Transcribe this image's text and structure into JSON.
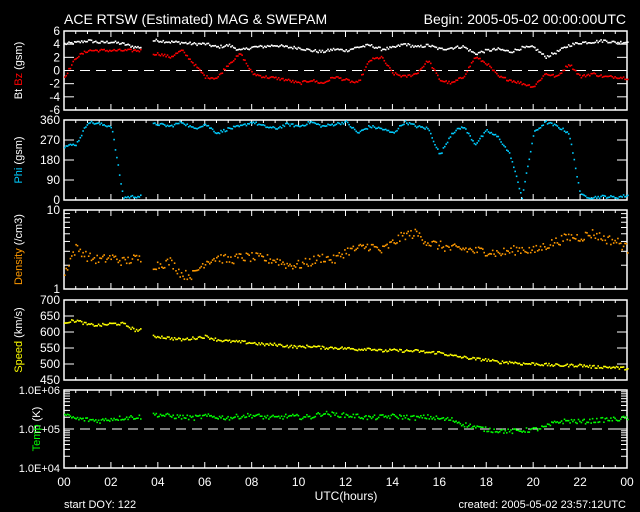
{
  "header": {
    "title": "ACE RTSW (Estimated) MAG & SWEPAM",
    "begin": "Begin: 2005-05-02 00:00:00UTC"
  },
  "footer": {
    "start_doy": "start DOY: 122",
    "created": "created: 2005-05-02 23:57:12UTC",
    "xlabel": "UTC(hours)"
  },
  "chart_data": [
    {
      "type": "scatter",
      "ylabel_parts": [
        "Bt",
        "Bz",
        "(gsm)"
      ],
      "ylabel_colors": [
        "#ffffff",
        "#ff0000",
        "#ffffff"
      ],
      "ylim": [
        -6,
        6
      ],
      "yticks": [
        "6",
        "4",
        "2",
        "0",
        "-2",
        "-4",
        "-6"
      ],
      "reference_line": 0,
      "x": [
        0,
        0.5,
        1,
        1.5,
        2,
        2.5,
        3,
        3.5,
        4,
        4.5,
        5,
        5.5,
        6,
        6.5,
        7,
        7.5,
        8,
        8.5,
        9,
        9.5,
        10,
        10.5,
        11,
        11.5,
        12,
        12.5,
        13,
        13.5,
        14,
        14.5,
        15,
        15.5,
        16,
        16.5,
        17,
        17.5,
        18,
        18.5,
        19,
        19.5,
        20,
        20.5,
        21,
        21.5,
        22,
        22.5,
        23,
        23.5,
        24
      ],
      "series": [
        {
          "name": "Bt",
          "color": "#ffffff",
          "values": [
            4,
            4.2,
            4.5,
            4.2,
            4.3,
            4,
            3.5,
            null,
            4.5,
            4.3,
            4.2,
            4,
            4,
            3.5,
            3.8,
            3,
            3.5,
            3.6,
            3.8,
            3.5,
            3.4,
            3,
            2.8,
            3.2,
            3,
            3.5,
            3.8,
            3.2,
            3.4,
            4,
            3.5,
            3.8,
            3.2,
            3.4,
            3.6,
            2.5,
            3,
            3.2,
            2.8,
            3.4,
            3.5,
            2,
            2.8,
            3.8,
            4.2,
            4.3,
            4.5,
            4.2,
            4.3
          ]
        },
        {
          "name": "Bz",
          "color": "#ff0000",
          "values": [
            -1,
            2,
            3,
            3,
            3,
            3,
            3,
            null,
            2.5,
            2,
            3,
            1,
            -1,
            -1.2,
            1,
            2.5,
            -0.5,
            -1,
            -1.2,
            -1.5,
            -2,
            -1.5,
            -2,
            -1,
            -1.5,
            -2,
            1.5,
            2,
            -0.5,
            -1,
            -0.5,
            1.5,
            -1.5,
            -2,
            -1,
            2,
            1,
            -1,
            -1.5,
            -2,
            -2.5,
            -0.5,
            -1,
            1,
            -1,
            -0.5,
            -1,
            -1,
            -1.2
          ]
        }
      ]
    },
    {
      "type": "scatter",
      "ylabel_parts": [
        "Phi",
        "(gsm)"
      ],
      "ylabel_colors": [
        "#00ccff",
        "#ffffff"
      ],
      "ylim": [
        0,
        360
      ],
      "yticks": [
        "360",
        "270",
        "180",
        "90",
        "0"
      ],
      "x": [
        0,
        0.5,
        1,
        1.5,
        2,
        2.5,
        3,
        3.5,
        4,
        4.5,
        5,
        5.5,
        6,
        6.5,
        7,
        7.5,
        8,
        8.5,
        9,
        9.5,
        10,
        10.5,
        11,
        11.5,
        12,
        12.5,
        13,
        13.5,
        14,
        14.5,
        15,
        15.5,
        16,
        16.5,
        17,
        17.5,
        18,
        18.5,
        19,
        19.5,
        20,
        20.5,
        21,
        21.5,
        22,
        22.5,
        23,
        23.5,
        24
      ],
      "series": [
        {
          "name": "Phi",
          "color": "#00ccff",
          "values": [
            240,
            250,
            350,
            340,
            330,
            10,
            15,
            null,
            340,
            330,
            350,
            320,
            340,
            300,
            320,
            330,
            350,
            330,
            320,
            340,
            330,
            350,
            330,
            340,
            350,
            300,
            330,
            320,
            300,
            350,
            330,
            320,
            200,
            300,
            330,
            250,
            310,
            280,
            200,
            10,
            300,
            350,
            330,
            300,
            20,
            10,
            15,
            10,
            20
          ]
        }
      ]
    },
    {
      "type": "scatter",
      "ylabel_parts": [
        "Density",
        "(/cm3)"
      ],
      "ylabel_colors": [
        "#ff9900",
        "#ffffff"
      ],
      "yscale": "log",
      "ylim": [
        1,
        10
      ],
      "yticks": [
        "10",
        "1"
      ],
      "x": [
        0,
        0.5,
        1,
        1.5,
        2,
        2.5,
        3,
        3.5,
        4,
        4.5,
        5,
        5.5,
        6,
        6.5,
        7,
        7.5,
        8,
        8.5,
        9,
        9.5,
        10,
        10.5,
        11,
        11.5,
        12,
        12.5,
        13,
        13.5,
        14,
        14.5,
        15,
        15.5,
        16,
        16.5,
        17,
        17.5,
        18,
        18.5,
        19,
        19.5,
        20,
        20.5,
        21,
        21.5,
        22,
        22.5,
        23,
        23.5,
        24
      ],
      "series": [
        {
          "name": "Density",
          "color": "#ff9900",
          "values": [
            1.5,
            3.3,
            2.5,
            2.3,
            2.5,
            2.2,
            2.4,
            null,
            2,
            2.2,
            1.5,
            1.5,
            2.2,
            2.5,
            2.3,
            2.5,
            2.5,
            2.4,
            2.3,
            2,
            2,
            2.2,
            2.5,
            2.3,
            3,
            3.2,
            3.5,
            3,
            3.8,
            4.8,
            5,
            3.8,
            3.5,
            3.2,
            3.2,
            3,
            3,
            2.8,
            3,
            3.2,
            3,
            3.5,
            4,
            4.5,
            4.5,
            5,
            4.3,
            4,
            3.2
          ]
        }
      ]
    },
    {
      "type": "scatter",
      "ylabel_parts": [
        "Speed",
        "(km/s)"
      ],
      "ylabel_colors": [
        "#ffff00",
        "#ffffff"
      ],
      "ylim": [
        450,
        700
      ],
      "yticks": [
        "700",
        "650",
        "600",
        "550",
        "500",
        "450"
      ],
      "x": [
        0,
        0.5,
        1,
        1.5,
        2,
        2.5,
        3,
        3.5,
        4,
        4.5,
        5,
        5.5,
        6,
        6.5,
        7,
        7.5,
        8,
        8.5,
        9,
        9.5,
        10,
        10.5,
        11,
        11.5,
        12,
        12.5,
        13,
        13.5,
        14,
        14.5,
        15,
        15.5,
        16,
        16.5,
        17,
        17.5,
        18,
        18.5,
        19,
        19.5,
        20,
        20.5,
        21,
        21.5,
        22,
        22.5,
        23,
        23.5,
        24
      ],
      "series": [
        {
          "name": "Speed",
          "color": "#ffff00",
          "values": [
            630,
            635,
            622,
            620,
            625,
            625,
            605,
            null,
            585,
            580,
            575,
            580,
            585,
            575,
            570,
            568,
            565,
            560,
            560,
            555,
            552,
            555,
            550,
            550,
            548,
            545,
            548,
            540,
            542,
            540,
            540,
            535,
            535,
            525,
            520,
            515,
            512,
            505,
            505,
            500,
            500,
            497,
            495,
            495,
            495,
            490,
            490,
            488,
            485
          ]
        }
      ]
    },
    {
      "type": "scatter",
      "ylabel_parts": [
        "Temp",
        "(K)"
      ],
      "ylabel_colors": [
        "#00ff00",
        "#ffffff"
      ],
      "yscale": "log",
      "ylim": [
        10000,
        1000000
      ],
      "yticks": [
        "1.0E+06",
        "1.0E+05",
        "1.0E+04"
      ],
      "reference_line": 100000,
      "x": [
        0,
        0.5,
        1,
        1.5,
        2,
        2.5,
        3,
        3.5,
        4,
        4.5,
        5,
        5.5,
        6,
        6.5,
        7,
        7.5,
        8,
        8.5,
        9,
        9.5,
        10,
        10.5,
        11,
        11.5,
        12,
        12.5,
        13,
        13.5,
        14,
        14.5,
        15,
        15.5,
        16,
        16.5,
        17,
        17.5,
        18,
        18.5,
        19,
        19.5,
        20,
        20.5,
        21,
        21.5,
        22,
        22.5,
        23,
        23.5,
        24
      ],
      "series": [
        {
          "name": "Temp",
          "color": "#00ff00",
          "values": [
            220000,
            180000,
            170000,
            160000,
            180000,
            190000,
            200000,
            null,
            230000,
            210000,
            200000,
            190000,
            210000,
            200000,
            190000,
            210000,
            220000,
            200000,
            190000,
            210000,
            200000,
            200000,
            250000,
            230000,
            220000,
            210000,
            190000,
            200000,
            210000,
            200000,
            190000,
            200000,
            180000,
            170000,
            130000,
            110000,
            95000,
            90000,
            85000,
            90000,
            95000,
            110000,
            150000,
            160000,
            150000,
            160000,
            170000,
            175000,
            190000
          ]
        }
      ]
    }
  ],
  "xaxis": {
    "ticks": [
      "00",
      "02",
      "04",
      "06",
      "08",
      "10",
      "12",
      "14",
      "16",
      "18",
      "20",
      "22",
      "00"
    ],
    "xlim": [
      0,
      24
    ]
  }
}
